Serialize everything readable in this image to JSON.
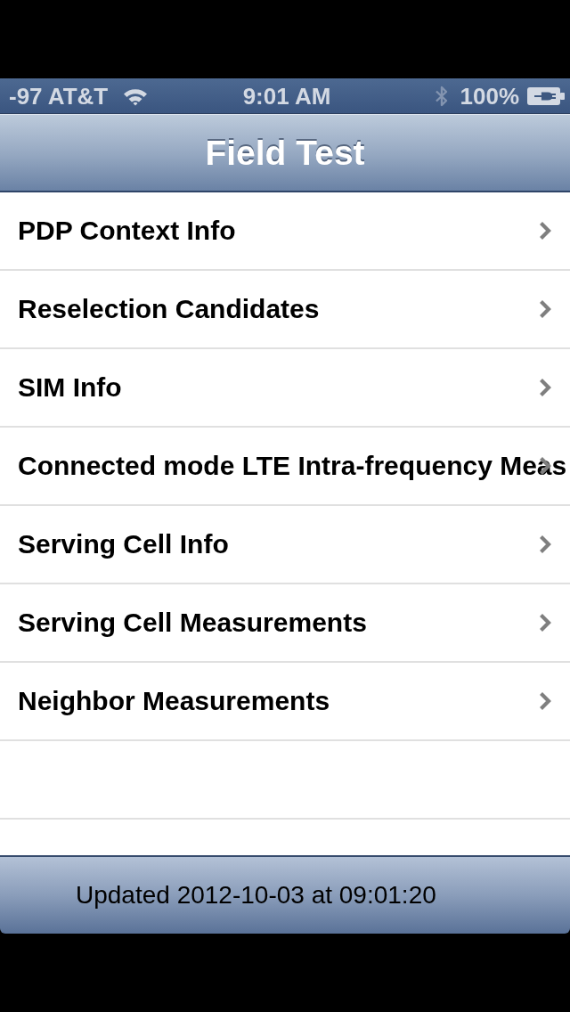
{
  "status_bar": {
    "carrier": "-97 AT&T",
    "time": "9:01 AM",
    "battery": "100%"
  },
  "nav_bar": {
    "title": "Field Test"
  },
  "rows": [
    {
      "label": "PDP Context Info"
    },
    {
      "label": "Reselection Candidates"
    },
    {
      "label": "SIM Info"
    },
    {
      "label": "Connected mode LTE Intra-frequency Meas"
    },
    {
      "label": "Serving Cell Info"
    },
    {
      "label": "Serving Cell Measurements"
    },
    {
      "label": "Neighbor Measurements"
    }
  ],
  "toolbar": {
    "text": "Updated 2012-10-03 at 09:01:20"
  }
}
